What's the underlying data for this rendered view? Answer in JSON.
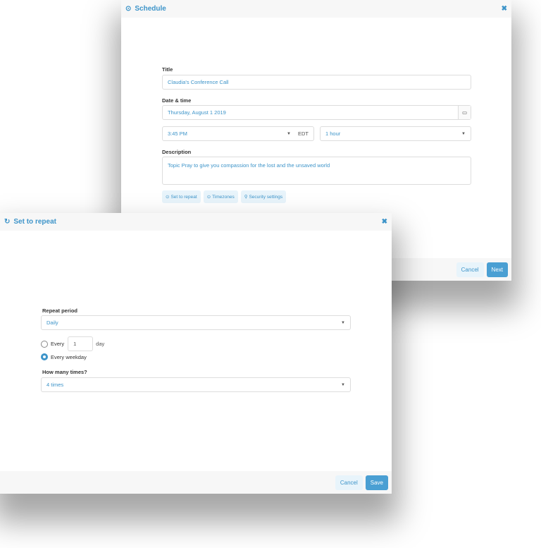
{
  "schedule": {
    "title": "Schedule",
    "icon": "clock-icon",
    "title_label": "Title",
    "title_value": "Claudia's Conference Call",
    "datetime_label": "Date & time",
    "date_value": "Thursday, August 1 2019",
    "time_value": "3:45 PM",
    "timezone": "EDT",
    "duration_value": "1 hour",
    "description_label": "Description",
    "description_value": "Topic Pray to give you compassion for the lost and the unsaved world",
    "chips": [
      "Set to repeat",
      "Timezones",
      "Security settings"
    ],
    "cancel": "Cancel",
    "next": "Next"
  },
  "repeat": {
    "title": "Set to repeat",
    "icon": "refresh-icon",
    "period_label": "Repeat period",
    "period_value": "Daily",
    "every_label": "Every",
    "every_value": "1",
    "every_unit": "day",
    "weekday_label": "Every weekday",
    "selected": "Every weekday",
    "times_label": "How many times?",
    "times_value": "4 times",
    "cancel": "Cancel",
    "save": "Save"
  },
  "colors": {
    "accent": "#3d94c9",
    "primary_button": "#4a9fd3"
  }
}
